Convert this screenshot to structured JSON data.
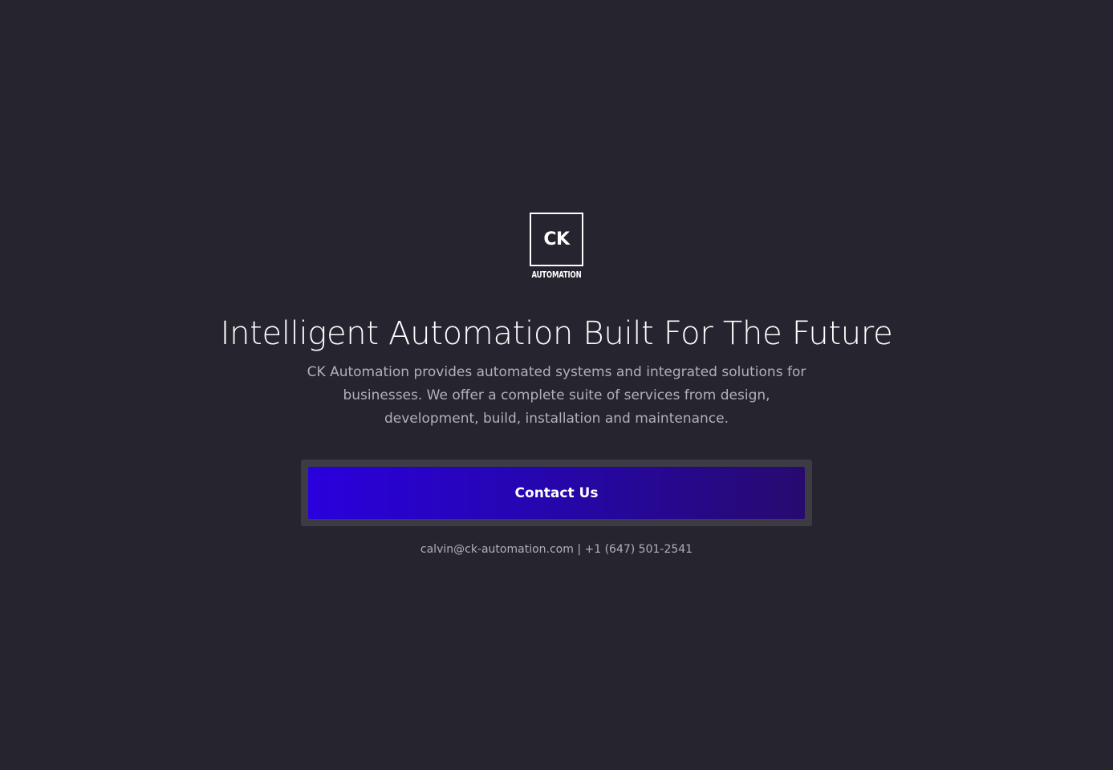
{
  "logo": {
    "mark": "CK",
    "wordmark": "AUTOMATION"
  },
  "hero": {
    "headline": "Intelligent Automation Built For The Future",
    "description": "CK Automation provides automated systems and integrated solutions for businesses. We offer a complete suite of services from design, development, build, installation and maintenance."
  },
  "cta": {
    "label": "Contact Us"
  },
  "contact": {
    "email": "calvin@ck-automation.com",
    "separator": "|",
    "phone": "+1 (647) 501-2541"
  },
  "colors": {
    "background": "#26252f",
    "button_gradient_start": "#2a00dd",
    "button_gradient_end": "#270a6e",
    "button_frame": "#3d3c45",
    "muted_text": "#b1b0ba"
  }
}
